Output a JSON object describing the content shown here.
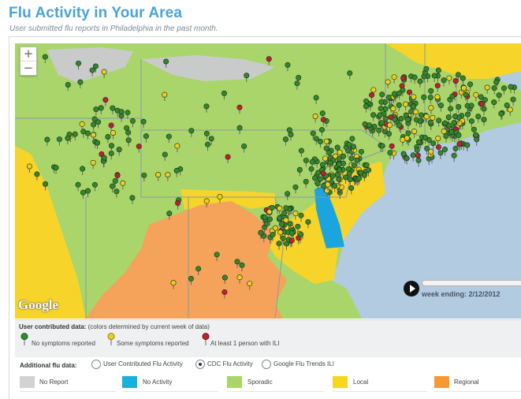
{
  "header": {
    "title": "Flu Activity in Your Area",
    "subtitle": "User submitted flu reports in Philadelphia in the past month."
  },
  "map": {
    "zoom_in_label": "+",
    "zoom_out_label": "−",
    "attribution": "Google",
    "colors": {
      "water": "#b2cbe0",
      "sporadic": "#a9d56b",
      "local": "#f6d42a",
      "regional": "#f5a35a",
      "no_activity": "#1ba5de",
      "no_report": "#cfd0cc",
      "pin_green": "#2f8a27",
      "pin_yellow": "#e9d11a",
      "pin_red": "#c0202c"
    }
  },
  "player": {
    "play_icon": "play-icon",
    "week_label": "week ending: 2/12/2012"
  },
  "legend": {
    "title_bold": "User contributed data:",
    "title_rest": "(colors determined by current week of data)",
    "pins": [
      {
        "label": "No symptoms reported",
        "color": "#2f8a27"
      },
      {
        "label": "Some symptoms reported",
        "color": "#e9d11a"
      },
      {
        "label": "At least 1 person with ILI",
        "color": "#c0202c"
      }
    ]
  },
  "additional": {
    "label": "Additional flu data:",
    "options": [
      {
        "label": "User Contributed Flu Activity",
        "selected": false
      },
      {
        "label": "CDC Flu Activity",
        "selected": true
      },
      {
        "label": "Google Flu Trends ILI",
        "selected": false
      }
    ],
    "swatches": [
      {
        "label": "No Report",
        "color": "#d2d2d2"
      },
      {
        "label": "No Activity",
        "color": "#1ab0dc"
      },
      {
        "label": "Sporadic",
        "color": "#a9d56b"
      },
      {
        "label": "Local",
        "color": "#f7d61b"
      },
      {
        "label": "Regional",
        "color": "#f8992f"
      }
    ]
  }
}
